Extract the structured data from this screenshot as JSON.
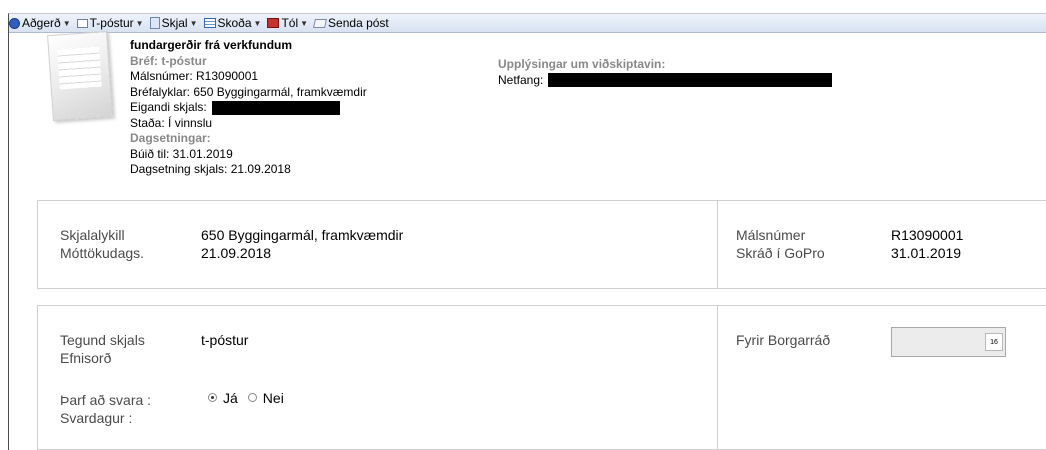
{
  "toolbar": {
    "items": [
      {
        "label": "Aðgerð",
        "icon": "globe-icon"
      },
      {
        "label": "T-póstur",
        "icon": "mail-icon"
      },
      {
        "label": "Skjal",
        "icon": "document-icon"
      },
      {
        "label": "Skoða",
        "icon": "view-icon"
      },
      {
        "label": "Tól",
        "icon": "toolbox-icon"
      },
      {
        "label": "Senda póst",
        "icon": "send-mail-icon"
      }
    ]
  },
  "header": {
    "title": "fundargerðir frá verkfundum",
    "doc_type_label": "Bréf: t-póstur",
    "case_number": "Málsnúmer:  R13090001",
    "doc_keys": "Bréfalyklar:  650 Byggingarmál, framkvæmdir",
    "owner_label": "Eigandi skjals:",
    "status": "Staða:  Í vinnslu",
    "dates_heading": "Dagsetningar:",
    "created": "Búið til:  31.01.2019",
    "doc_date": "Dagsetning skjals: 21.09.2018",
    "customer_heading": "Upplýsingar um viðskiptavin:",
    "email_label": "Netfang:"
  },
  "panel1": {
    "key_label": "Skjalalykill",
    "key_value": "650 Byggingarmál, framkvæmdir",
    "received_label": "Móttökudags.",
    "received_value": "21.09.2018",
    "case_label": "Málsnúmer",
    "case_value": "R13090001",
    "registered_label": "Skráð í GoPro",
    "registered_value": "31.01.2019"
  },
  "panel2": {
    "type_label": "Tegund skjals",
    "type_value": "t-póstur",
    "keywords_label": "Efnisorð",
    "reply_label": "Þarf að svara :",
    "reply_day_label": "Svardagur :",
    "yes": "Já",
    "no": "Nei",
    "reply_selected": "Já",
    "council_label": "Fyrir Borgarráð",
    "spinner_value": "16"
  }
}
